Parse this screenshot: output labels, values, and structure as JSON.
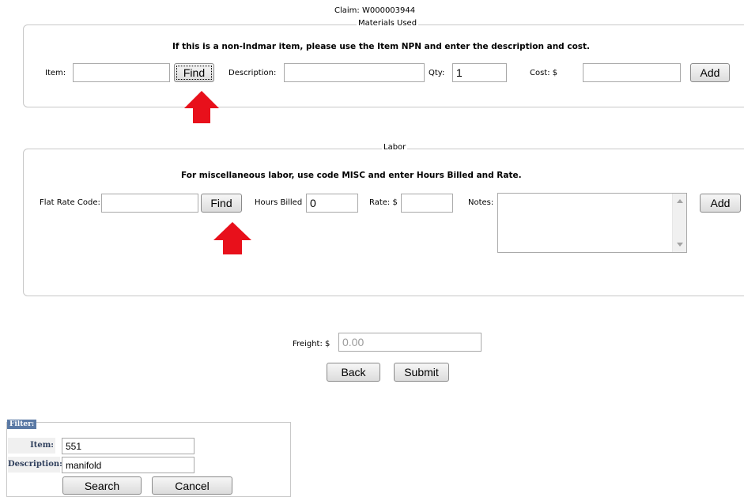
{
  "claim": {
    "label": "Claim:",
    "number": "W000003944"
  },
  "materials": {
    "legend": "Materials Used",
    "instruction": "If this is a non-Indmar item, please use the Item NPN and enter the description and cost.",
    "item_label": "Item:",
    "item_value": "",
    "find_label": "Find",
    "description_label": "Description:",
    "description_value": "",
    "qty_label": "Qty:",
    "qty_value": "1",
    "cost_label": "Cost: $",
    "cost_value": "",
    "add_label": "Add"
  },
  "labor": {
    "legend": "Labor",
    "instruction": "For miscellaneous labor, use code MISC and enter Hours Billed and Rate.",
    "flat_rate_label": "Flat Rate Code:",
    "flat_rate_value": "",
    "find_label": "Find",
    "hours_label": "Hours Billed",
    "hours_value": "0",
    "rate_label": "Rate: $",
    "rate_value": "",
    "notes_label": "Notes:",
    "notes_value": "",
    "add_label": "Add"
  },
  "freight": {
    "label": "Freight: $",
    "value": "0.00"
  },
  "actions": {
    "back_label": "Back",
    "submit_label": "Submit"
  },
  "filter": {
    "title": "Filter:",
    "item_label": "Item:",
    "item_value": "551",
    "description_label": "Description:",
    "description_value": "manifold",
    "search_label": "Search",
    "cancel_label": "Cancel"
  },
  "colors": {
    "arrow": "#e8101b",
    "filter_header": "#5a79a5"
  }
}
